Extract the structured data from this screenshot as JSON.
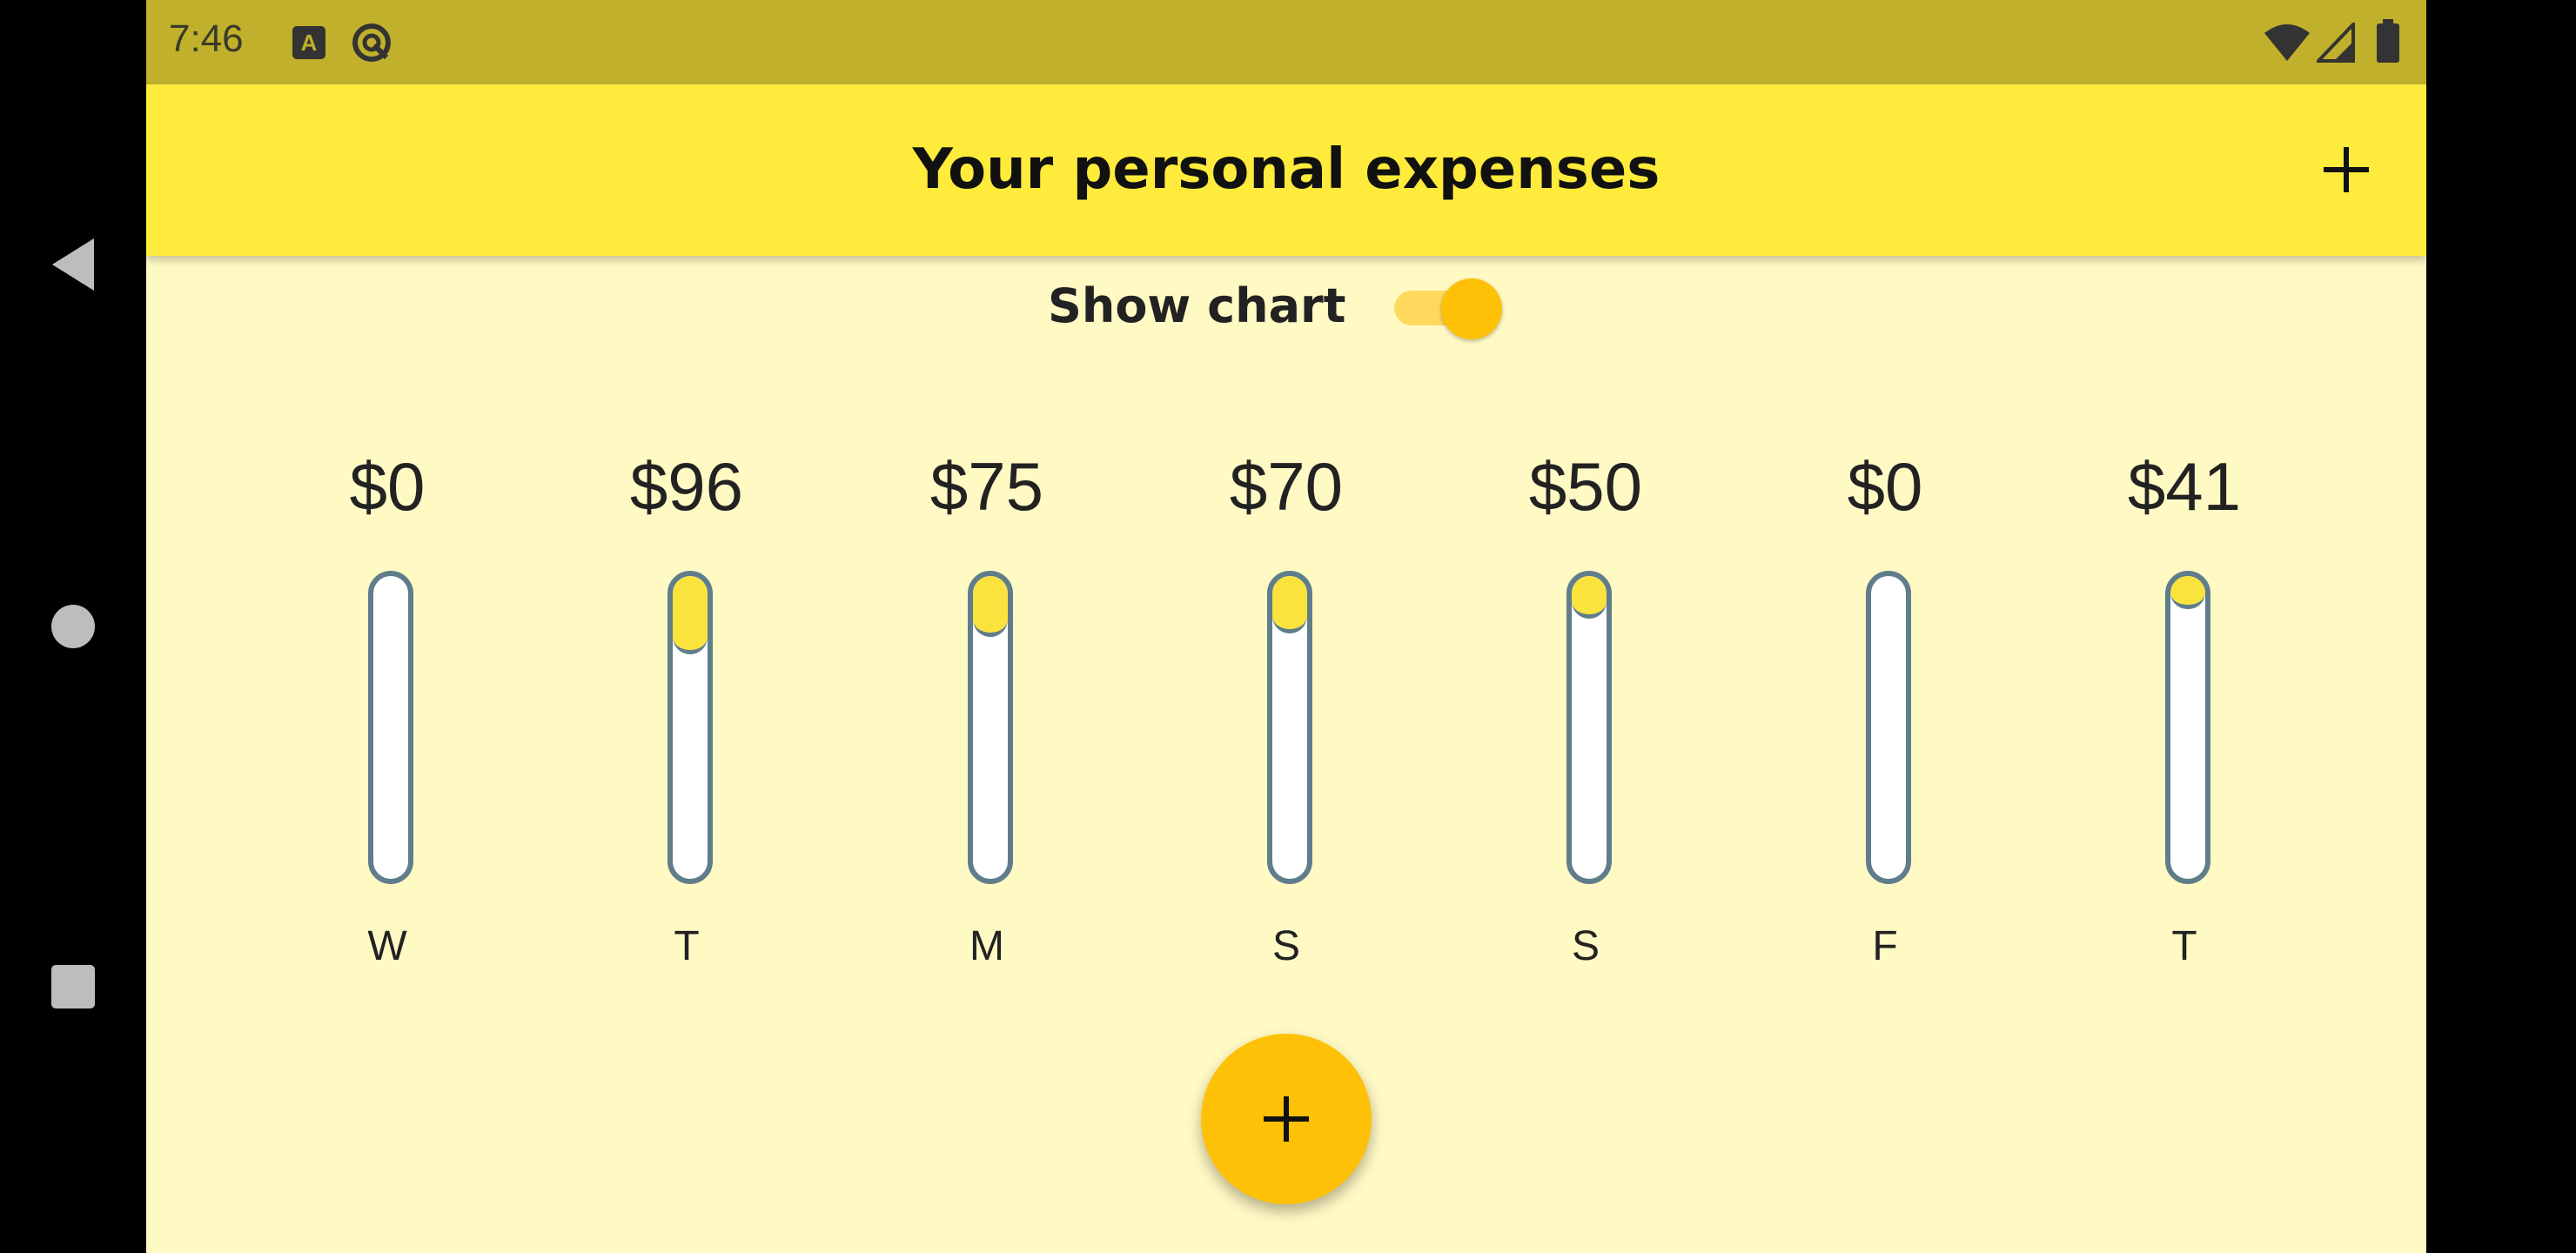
{
  "status_bar": {
    "time": "7:46",
    "notification_badge": "A"
  },
  "app_bar": {
    "title": "Your personal expenses",
    "add_icon": "plus-icon"
  },
  "toggle": {
    "label": "Show chart",
    "on": true
  },
  "chart_data": {
    "type": "bar",
    "categories": [
      "W",
      "T",
      "M",
      "S",
      "S",
      "F",
      "T"
    ],
    "value_labels": [
      "$0",
      "$96",
      "$75",
      "$70",
      "$50",
      "$0",
      "$41"
    ],
    "values": [
      0,
      96,
      75,
      70,
      50,
      0,
      41
    ],
    "fill_fractions": [
      0,
      0.26,
      0.2,
      0.19,
      0.14,
      0,
      0.11
    ],
    "bar_fill_color": "#fbe33e",
    "bar_border_color": "#607d8b"
  },
  "fab": {
    "icon": "plus-icon"
  },
  "colors": {
    "status_bar": "#c0b02b",
    "app_bar": "#ffeb3b",
    "background": "#fff9c4",
    "accent": "#ffc107"
  }
}
